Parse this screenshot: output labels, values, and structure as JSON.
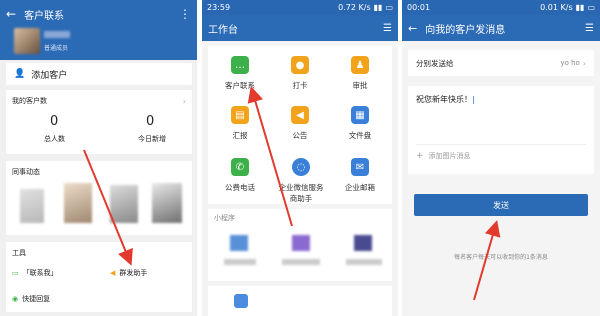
{
  "panel1": {
    "title": "客户联系",
    "member_role": "普通成员",
    "add_customer": "添加客户",
    "my_customers_title": "我的客户数",
    "stats": [
      {
        "value": "0",
        "label": "总人数"
      },
      {
        "value": "0",
        "label": "今日新增"
      }
    ],
    "colleague_activity": "同事动态",
    "tools_title": "工具",
    "tools": [
      {
        "label": "「联系我」",
        "icon": "contact-me-icon"
      },
      {
        "label": "群发助手",
        "icon": "broadcast-icon"
      },
      {
        "label": "快捷回复",
        "icon": "quick-reply-icon"
      }
    ]
  },
  "panel2": {
    "status_time": "23:59",
    "status_speed": "0.72 K/s",
    "title": "工作台",
    "apps": [
      {
        "label": "客户联系",
        "color": "#3cb049"
      },
      {
        "label": "打卡",
        "color": "#f2a31c"
      },
      {
        "label": "审批",
        "color": "#f2a31c"
      },
      {
        "label": "汇报",
        "color": "#f2a31c"
      },
      {
        "label": "公告",
        "color": "#f2a31c"
      },
      {
        "label": "文件盘",
        "color": "#3a80d8"
      },
      {
        "label": "公费电话",
        "color": "#3cb049"
      },
      {
        "label": "企业微信服务",
        "label2": "商助手",
        "color": "#3a80d8"
      },
      {
        "label": "企业邮箱",
        "color": "#3a80d8"
      }
    ],
    "mini_programs": "小程序"
  },
  "panel3": {
    "status_time": "00:01",
    "status_speed": "0.01 K/s",
    "title": "向我的客户发消息",
    "send_to_label": "分别发送给",
    "send_to_value": "yo ho",
    "message": "祝您新年快乐！",
    "add_image": "添加图片消息",
    "send_button": "发送",
    "footnote": "每名客户每天可以收到你的1条消息"
  }
}
